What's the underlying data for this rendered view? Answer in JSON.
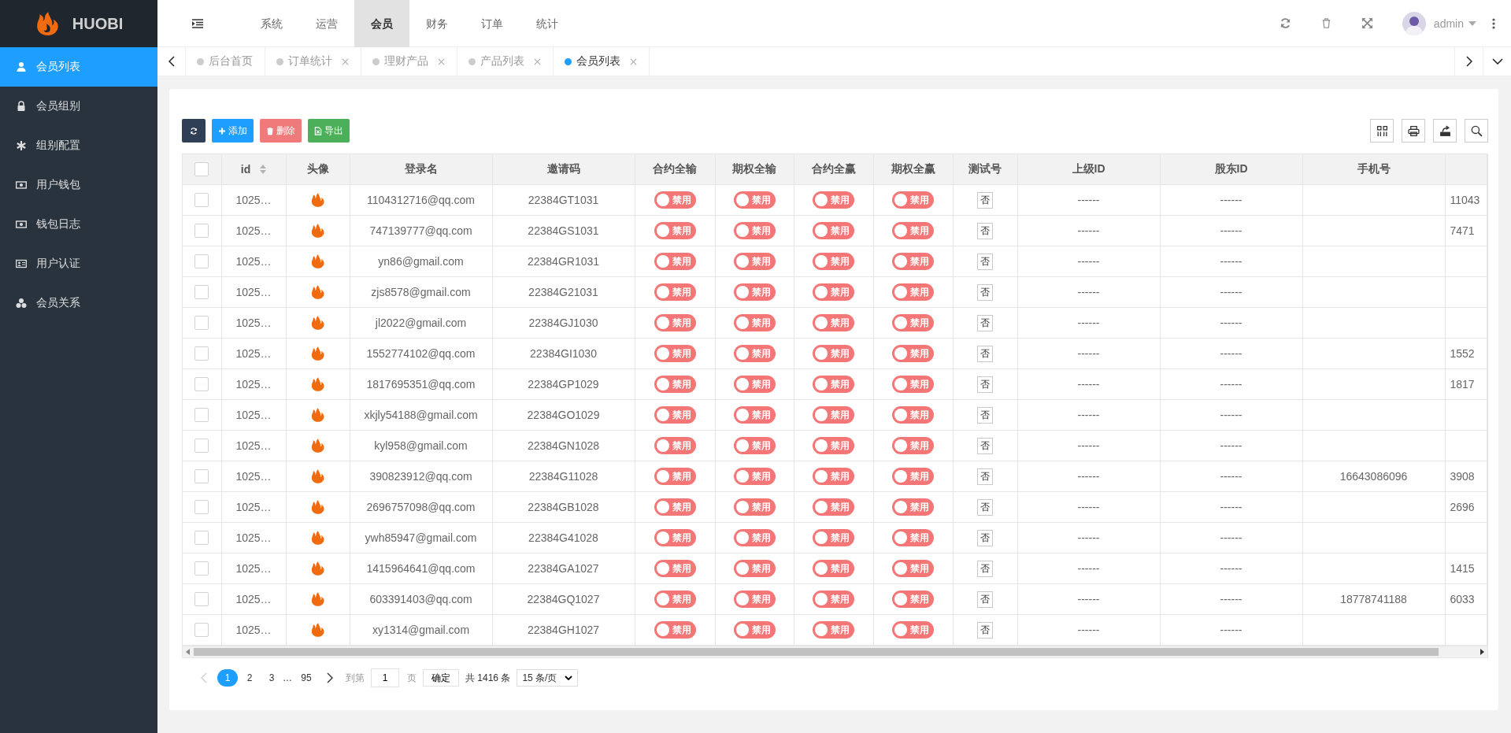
{
  "brand": {
    "name": "HUOBI"
  },
  "top_nav": [
    {
      "label": "系统",
      "selected": false
    },
    {
      "label": "运营",
      "selected": false
    },
    {
      "label": "会员",
      "selected": true
    },
    {
      "label": "财务",
      "selected": false
    },
    {
      "label": "订单",
      "selected": false
    },
    {
      "label": "统计",
      "selected": false
    }
  ],
  "user": {
    "name": "admin"
  },
  "sidebar": {
    "items": [
      {
        "label": "会员列表",
        "selected": true
      },
      {
        "label": "会员组别",
        "selected": false
      },
      {
        "label": "组别配置",
        "selected": false
      },
      {
        "label": "用户钱包",
        "selected": false
      },
      {
        "label": "钱包日志",
        "selected": false
      },
      {
        "label": "用户认证",
        "selected": false
      },
      {
        "label": "会员关系",
        "selected": false
      }
    ]
  },
  "tabs": [
    {
      "label": "后台首页",
      "selected": false,
      "closable": false
    },
    {
      "label": "订单统计",
      "selected": false,
      "closable": true
    },
    {
      "label": "理财产品",
      "selected": false,
      "closable": true
    },
    {
      "label": "产品列表",
      "selected": false,
      "closable": true
    },
    {
      "label": "会员列表",
      "selected": true,
      "closable": true
    }
  ],
  "toolbar": {
    "buttons": [
      {
        "kind": "add",
        "label": "添加"
      },
      {
        "kind": "delete",
        "label": "删除"
      },
      {
        "kind": "export",
        "label": "导出"
      }
    ]
  },
  "table": {
    "select_all": {
      "checked": false
    },
    "columns": [
      "id",
      "头像",
      "登录名",
      "邀请码",
      "合约全输",
      "期权全输",
      "合约全赢",
      "期权全赢",
      "测试号",
      "上级ID",
      "股东ID",
      "手机号"
    ],
    "rows": [
      {
        "id": "1025…",
        "login": "1104312716@qq.com",
        "invite": "22384GT1031",
        "switches": [
          {
            "label": "禁用",
            "on": false
          },
          {
            "label": "禁用",
            "on": false
          },
          {
            "label": "禁用",
            "on": false
          },
          {
            "label": "禁用",
            "on": false
          }
        ],
        "test": "否",
        "parent": "------",
        "shareholder": "------",
        "phone": "",
        "column_14": "11043",
        "checked": false
      },
      {
        "id": "1025…",
        "login": "747139777@qq.com",
        "invite": "22384GS1031",
        "switches": [
          {
            "label": "禁用",
            "on": false
          },
          {
            "label": "禁用",
            "on": false
          },
          {
            "label": "禁用",
            "on": false
          },
          {
            "label": "禁用",
            "on": false
          }
        ],
        "test": "否",
        "parent": "------",
        "shareholder": "------",
        "phone": "",
        "column_14": "7471",
        "checked": false
      },
      {
        "id": "1025…",
        "login": "yn86@gmail.com",
        "invite": "22384GR1031",
        "switches": [
          {
            "label": "禁用",
            "on": false
          },
          {
            "label": "禁用",
            "on": false
          },
          {
            "label": "禁用",
            "on": false
          },
          {
            "label": "禁用",
            "on": false
          }
        ],
        "test": "否",
        "parent": "------",
        "shareholder": "------",
        "phone": "",
        "column_14": "",
        "checked": false
      },
      {
        "id": "1025…",
        "login": "zjs8578@gmail.com",
        "invite": "22384G21031",
        "switches": [
          {
            "label": "禁用",
            "on": false
          },
          {
            "label": "禁用",
            "on": false
          },
          {
            "label": "禁用",
            "on": false
          },
          {
            "label": "禁用",
            "on": false
          }
        ],
        "test": "否",
        "parent": "------",
        "shareholder": "------",
        "phone": "",
        "column_14": "",
        "checked": false
      },
      {
        "id": "1025…",
        "login": "jl2022@gmail.com",
        "invite": "22384GJ1030",
        "switches": [
          {
            "label": "禁用",
            "on": false
          },
          {
            "label": "禁用",
            "on": false
          },
          {
            "label": "禁用",
            "on": false
          },
          {
            "label": "禁用",
            "on": false
          }
        ],
        "test": "否",
        "parent": "------",
        "shareholder": "------",
        "phone": "",
        "column_14": "",
        "checked": false
      },
      {
        "id": "1025…",
        "login": "1552774102@qq.com",
        "invite": "22384GI1030",
        "switches": [
          {
            "label": "禁用",
            "on": false
          },
          {
            "label": "禁用",
            "on": false
          },
          {
            "label": "禁用",
            "on": false
          },
          {
            "label": "禁用",
            "on": false
          }
        ],
        "test": "否",
        "parent": "------",
        "shareholder": "------",
        "phone": "",
        "column_14": "1552",
        "checked": false
      },
      {
        "id": "1025…",
        "login": "1817695351@qq.com",
        "invite": "22384GP1029",
        "switches": [
          {
            "label": "禁用",
            "on": false
          },
          {
            "label": "禁用",
            "on": false
          },
          {
            "label": "禁用",
            "on": false
          },
          {
            "label": "禁用",
            "on": false
          }
        ],
        "test": "否",
        "parent": "------",
        "shareholder": "------",
        "phone": "",
        "column_14": "1817",
        "checked": false
      },
      {
        "id": "1025…",
        "login": "xkjly54188@gmail.com",
        "invite": "22384GO1029",
        "switches": [
          {
            "label": "禁用",
            "on": false
          },
          {
            "label": "禁用",
            "on": false
          },
          {
            "label": "禁用",
            "on": false
          },
          {
            "label": "禁用",
            "on": false
          }
        ],
        "test": "否",
        "parent": "------",
        "shareholder": "------",
        "phone": "",
        "column_14": "",
        "checked": false
      },
      {
        "id": "1025…",
        "login": "kyl958@gmail.com",
        "invite": "22384GN1028",
        "switches": [
          {
            "label": "禁用",
            "on": false
          },
          {
            "label": "禁用",
            "on": false
          },
          {
            "label": "禁用",
            "on": false
          },
          {
            "label": "禁用",
            "on": false
          }
        ],
        "test": "否",
        "parent": "------",
        "shareholder": "------",
        "phone": "",
        "column_14": "",
        "checked": false
      },
      {
        "id": "1025…",
        "login": "390823912@qq.com",
        "invite": "22384G11028",
        "switches": [
          {
            "label": "禁用",
            "on": false
          },
          {
            "label": "禁用",
            "on": false
          },
          {
            "label": "禁用",
            "on": false
          },
          {
            "label": "禁用",
            "on": false
          }
        ],
        "test": "否",
        "parent": "------",
        "shareholder": "------",
        "phone": "16643086096",
        "column_14": "3908",
        "checked": false
      },
      {
        "id": "1025…",
        "login": "2696757098@qq.com",
        "invite": "22384GB1028",
        "switches": [
          {
            "label": "禁用",
            "on": false
          },
          {
            "label": "禁用",
            "on": false
          },
          {
            "label": "禁用",
            "on": false
          },
          {
            "label": "禁用",
            "on": false
          }
        ],
        "test": "否",
        "parent": "------",
        "shareholder": "------",
        "phone": "",
        "column_14": "2696",
        "checked": false
      },
      {
        "id": "1025…",
        "login": "ywh85947@gmail.com",
        "invite": "22384G41028",
        "switches": [
          {
            "label": "禁用",
            "on": false
          },
          {
            "label": "禁用",
            "on": false
          },
          {
            "label": "禁用",
            "on": false
          },
          {
            "label": "禁用",
            "on": false
          }
        ],
        "test": "否",
        "parent": "------",
        "shareholder": "------",
        "phone": "",
        "column_14": "",
        "checked": false
      },
      {
        "id": "1025…",
        "login": "1415964641@qq.com",
        "invite": "22384GA1027",
        "switches": [
          {
            "label": "禁用",
            "on": false
          },
          {
            "label": "禁用",
            "on": false
          },
          {
            "label": "禁用",
            "on": false
          },
          {
            "label": "禁用",
            "on": false
          }
        ],
        "test": "否",
        "parent": "------",
        "shareholder": "------",
        "phone": "",
        "column_14": "1415",
        "checked": false
      },
      {
        "id": "1025…",
        "login": "603391403@qq.com",
        "invite": "22384GQ1027",
        "switches": [
          {
            "label": "禁用",
            "on": false
          },
          {
            "label": "禁用",
            "on": false
          },
          {
            "label": "禁用",
            "on": false
          },
          {
            "label": "禁用",
            "on": false
          }
        ],
        "test": "否",
        "parent": "------",
        "shareholder": "------",
        "phone": "18778741188",
        "column_14": "6033",
        "checked": false
      },
      {
        "id": "1025…",
        "login": "xy1314@gmail.com",
        "invite": "22384GH1027",
        "switches": [
          {
            "label": "禁用",
            "on": false
          },
          {
            "label": "禁用",
            "on": false
          },
          {
            "label": "禁用",
            "on": false
          },
          {
            "label": "禁用",
            "on": false
          }
        ],
        "test": "否",
        "parent": "------",
        "shareholder": "------",
        "phone": "",
        "column_14": "",
        "checked": false
      }
    ]
  },
  "pagination": {
    "pages": [
      {
        "label": "1",
        "selected": true
      },
      {
        "label": "2",
        "selected": false
      },
      {
        "label": "3",
        "selected": false
      }
    ],
    "ellipsis": "…",
    "last_page": "95",
    "goto_label": "到第",
    "goto_value": "1",
    "page_unit": "页",
    "confirm": "确定",
    "total": "共 1416 条",
    "page_size": "15 条/页"
  }
}
